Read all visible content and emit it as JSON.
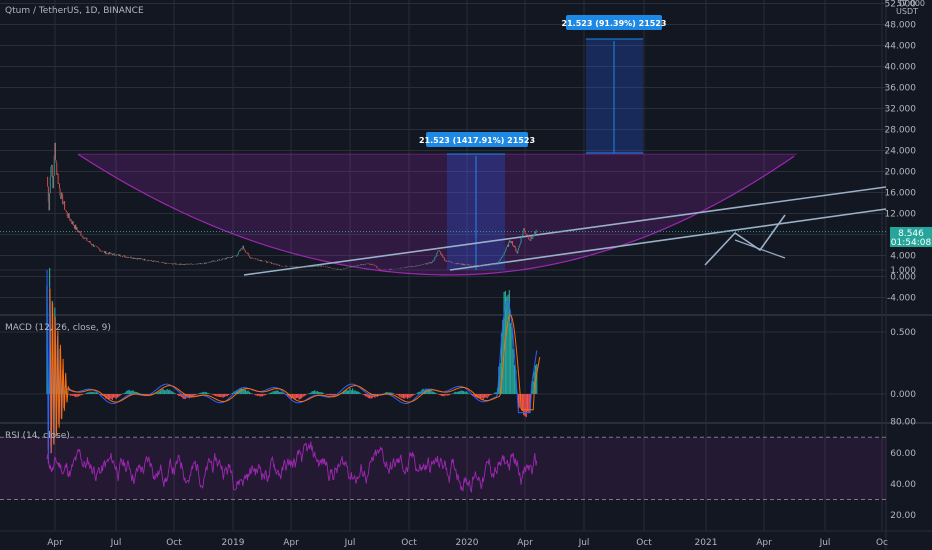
{
  "header": {
    "symbol_title": "Qtum / TetherUS, 1D, BINANCE",
    "axis_unit_top": "57.000",
    "axis_unit": "USDT"
  },
  "price_tag": {
    "price": "8.546",
    "countdown": "01:54:08",
    "color": "#26a69a"
  },
  "measures": [
    {
      "label": "21.523 (1417.91%) 21523"
    },
    {
      "label": "21.523 (91.39%) 21523"
    }
  ],
  "colors": {
    "background": "#131722",
    "grid": "#2a2e39",
    "up": "#26a69a",
    "down": "#ef5350",
    "curve": "#9c27b0",
    "trendline": "#9ab0c8",
    "macd_line": "#2962ff",
    "signal_line": "#ff6d00",
    "rsi_line": "#9c27b0",
    "measure_box": "#1e88e5"
  },
  "chart_data": [
    {
      "type": "line",
      "name": "price",
      "x_ticks": [
        "Apr",
        "Jul",
        "Oct",
        "2019",
        "Apr",
        "Jul",
        "Oct",
        "2020",
        "Apr",
        "Jul",
        "Oct",
        "2021",
        "Apr",
        "Jul",
        "Oc"
      ],
      "ylim": [
        -6,
        58
      ],
      "y_ticks": [
        -4,
        0,
        4,
        8,
        12,
        16,
        20,
        24,
        28,
        32,
        36,
        40,
        44,
        48,
        52
      ],
      "y_tick_labels": [
        "-4.000",
        "0.000",
        "4.000",
        "8.000",
        "12.000",
        "16.000",
        "20.000",
        "24.000",
        "28.000",
        "32.000",
        "36.000",
        "40.000",
        "44.000",
        "48.000",
        "52.000"
      ],
      "current_price": 8.546,
      "approx_points": [
        [
          0,
          19
        ],
        [
          3,
          13
        ],
        [
          6,
          22
        ],
        [
          9,
          17
        ],
        [
          12,
          25
        ],
        [
          15,
          20
        ],
        [
          20,
          16
        ],
        [
          30,
          12
        ],
        [
          45,
          9
        ],
        [
          60,
          7
        ],
        [
          75,
          5.5
        ],
        [
          90,
          4.5
        ],
        [
          120,
          3.8
        ],
        [
          150,
          3.2
        ],
        [
          180,
          2.5
        ],
        [
          210,
          2.3
        ],
        [
          240,
          2.5
        ],
        [
          270,
          3.3
        ],
        [
          290,
          4
        ],
        [
          300,
          5.6
        ],
        [
          310,
          3.7
        ],
        [
          330,
          3
        ],
        [
          360,
          2
        ],
        [
          390,
          1.8
        ],
        [
          420,
          2
        ],
        [
          440,
          1.5
        ],
        [
          450,
          1.3
        ],
        [
          470,
          2
        ],
        [
          490,
          2.4
        ],
        [
          500,
          2.3
        ],
        [
          510,
          1.2
        ],
        [
          520,
          1.3
        ],
        [
          540,
          1.6
        ],
        [
          570,
          2.1
        ],
        [
          590,
          2.7
        ],
        [
          600,
          5
        ],
        [
          610,
          3
        ],
        [
          630,
          2.4
        ],
        [
          660,
          2
        ],
        [
          690,
          2.4
        ],
        [
          700,
          4.5
        ],
        [
          710,
          7
        ],
        [
          720,
          4.5
        ],
        [
          730,
          9
        ],
        [
          740,
          7
        ],
        [
          750,
          8.5
        ]
      ]
    },
    {
      "type": "bar",
      "name": "MACD (12, 26, close, 9)",
      "ylim": [
        -0.5,
        1.2
      ],
      "y_ticks": [
        0,
        0.5,
        1.0
      ],
      "y_tick_labels": [
        "0.000",
        "0.500",
        "1.000"
      ]
    },
    {
      "type": "line",
      "name": "RSI (14, close)",
      "ylim": [
        14,
        90
      ],
      "y_ticks": [
        20,
        40,
        60,
        80
      ],
      "y_tick_labels": [
        "20.00",
        "40.00",
        "60.00",
        "80.00"
      ],
      "bands": [
        30,
        70
      ]
    }
  ]
}
